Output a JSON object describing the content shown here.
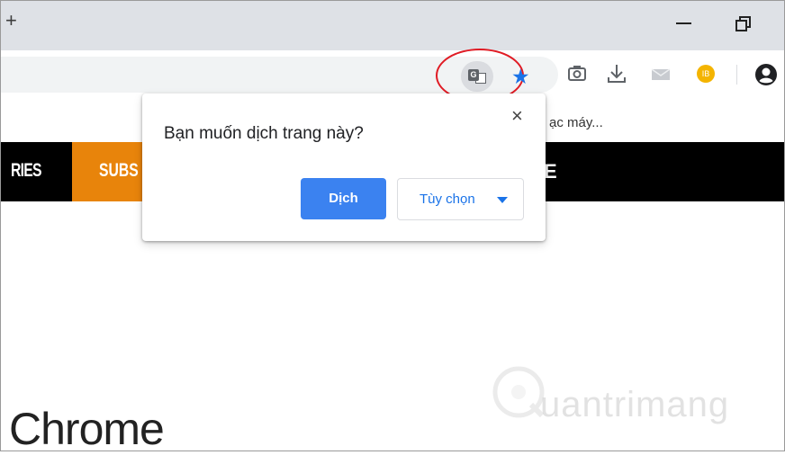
{
  "titlebar": {
    "new_tab_icon": "plus-icon",
    "minimize_icon": "minimize-icon",
    "restore_icon": "restore-icon"
  },
  "toolbar": {
    "icons": [
      "translate-icon",
      "bookmark-star-icon",
      "camera-icon",
      "download-icon",
      "mail-icon",
      "extension-icon",
      "profile-icon"
    ],
    "extension_badge": "IB",
    "accent": "#1a73e8",
    "highlight_color": "#e01b24"
  },
  "bookmarks": {
    "truncated_item": "ạc máy..."
  },
  "site_nav": {
    "item_left": "RIES",
    "subscribe": "SUBS",
    "item_right": "E",
    "subscribe_color": "#e8840b"
  },
  "popup": {
    "question": "Bạn muốn dịch trang này?",
    "translate_label": "Dịch",
    "options_label": "Tùy chọn",
    "close_label": "×"
  },
  "page": {
    "heading": "Chrome"
  },
  "watermark": {
    "text": "uantrimang"
  }
}
